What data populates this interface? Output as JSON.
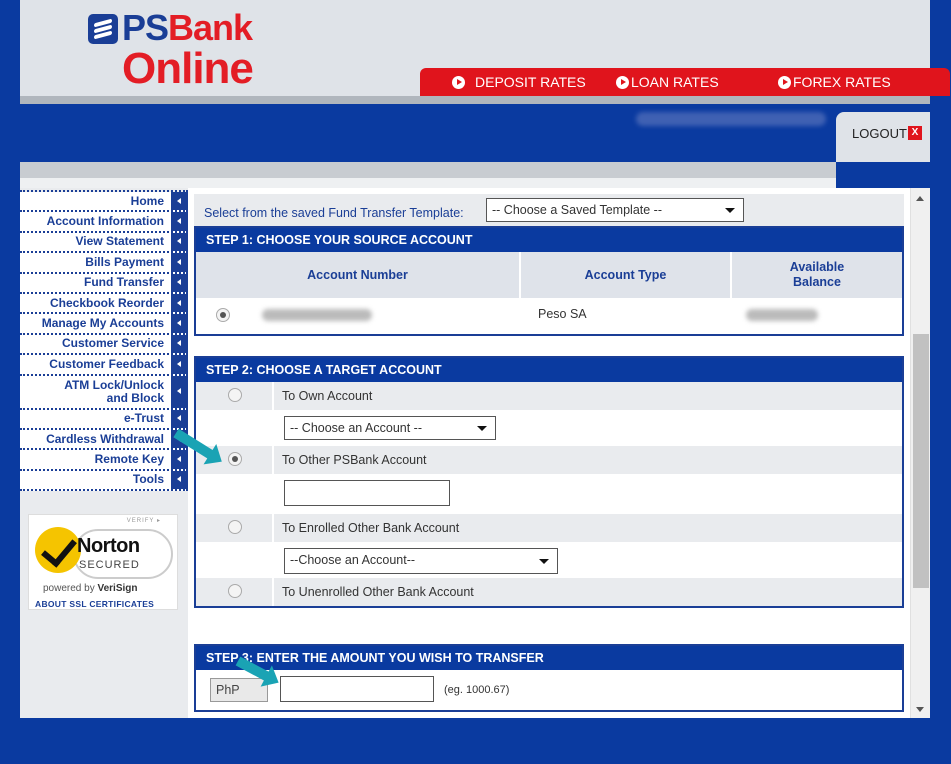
{
  "brand": {
    "name_part1": "PS",
    "name_part2": "Bank",
    "name_line2": "Online"
  },
  "rates": [
    {
      "label": "DEPOSIT RATES"
    },
    {
      "label": "LOAN RATES"
    },
    {
      "label": "FOREX RATES"
    }
  ],
  "header": {
    "logout_label": "LOGOUT",
    "logout_x": "X"
  },
  "sidebar": {
    "items": [
      {
        "label": "Home"
      },
      {
        "label": "Account Information"
      },
      {
        "label": "View Statement"
      },
      {
        "label": "Bills Payment"
      },
      {
        "label": "Fund Transfer"
      },
      {
        "label": "Checkbook Reorder"
      },
      {
        "label": "Manage My Accounts"
      },
      {
        "label": "Customer Service"
      },
      {
        "label": "Customer Feedback"
      },
      {
        "label": "ATM Lock/Unlock and Block"
      },
      {
        "label": "e-Trust"
      },
      {
        "label": "Cardless Withdrawal"
      },
      {
        "label": "Remote Key"
      },
      {
        "label": "Tools"
      }
    ]
  },
  "norton": {
    "verify": "VERIFY ▸",
    "brand": "Norton",
    "secured": "SECURED",
    "powered_prefix": "powered by ",
    "powered_brand": "VeriSign",
    "ssl_link": "ABOUT SSL CERTIFICATES"
  },
  "template": {
    "label": "Select from the saved Fund Transfer Template:",
    "selected": "-- Choose a Saved Template --"
  },
  "step1": {
    "title": "STEP 1: CHOOSE YOUR SOURCE ACCOUNT",
    "columns": [
      "Account Number",
      "Account Type",
      "Available Balance"
    ],
    "rows": [
      {
        "account_type": "Peso SA"
      }
    ]
  },
  "step2": {
    "title": "STEP 2: CHOOSE A TARGET ACCOUNT",
    "own": "To Own Account",
    "own_select": "-- Choose an Account --",
    "other_psbank": "To Other PSBank Account",
    "enrolled": "To Enrolled Other Bank Account",
    "enrolled_select": "--Choose an Account--",
    "unenrolled": "To Unenrolled Other Bank Account"
  },
  "step3": {
    "title": "STEP 3: ENTER THE AMOUNT YOU WISH TO TRANSFER",
    "currency": "PhP",
    "example": "(eg. 1000.67)"
  },
  "colors": {
    "primary_blue": "#0a3aa0",
    "brand_red": "#e0141c",
    "pointer_teal": "#1aa3b4"
  }
}
